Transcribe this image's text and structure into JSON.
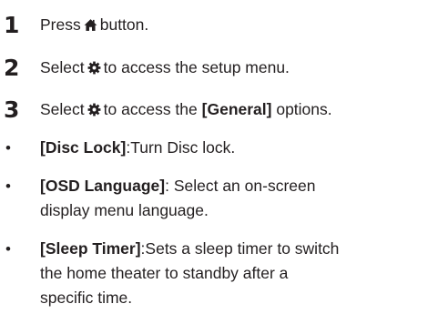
{
  "steps": [
    {
      "number": "1",
      "before": "Press",
      "icon": "home-icon",
      "after": "button."
    },
    {
      "number": "2",
      "before": "Select",
      "icon": "gear-icon",
      "after": "to access the setup menu."
    },
    {
      "number": "3",
      "before": "Select",
      "icon": "gear-icon",
      "after_plain": "to access the",
      "after_bold": "[General]",
      "after_tail": "options."
    }
  ],
  "options": [
    {
      "bullet": "•",
      "label": "[Disc Lock]",
      "lines": [
        ":Turn Disc lock."
      ]
    },
    {
      "bullet": "•",
      "label": "[OSD Language]",
      "lines": [
        ": Select an on-screen",
        "display menu language."
      ]
    },
    {
      "bullet": "•",
      "label": "[Sleep Timer]",
      "lines": [
        ":Sets a sleep timer to switch",
        "the home theater to standby after a",
        "specific time."
      ]
    }
  ],
  "colors": {
    "text": "#231f20",
    "background": "#ffffff"
  }
}
